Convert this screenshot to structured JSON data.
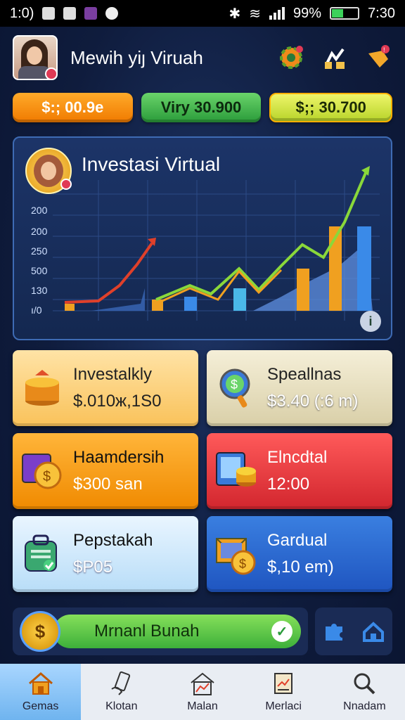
{
  "status": {
    "time_left": "1:0)",
    "battery": "99%",
    "time_right": "7:30"
  },
  "header": {
    "title": "Mewih yiȷ Viruah"
  },
  "pills": [
    "$:; 00.9e",
    "Viry 30.900",
    "$;; 30.700"
  ],
  "chart_card": {
    "title": "Investasi Virtual",
    "y_ticks": [
      "200",
      "200",
      "250",
      "500",
      "130",
      "ı/0"
    ],
    "colors": {
      "red": "#e0402a",
      "green": "#8ad83a",
      "orange": "#f0a020",
      "blue": "#3a78d8"
    }
  },
  "cards": [
    {
      "title": "Investalkly",
      "value": "$.010ж,1S0",
      "icon": "coin-stack-icon"
    },
    {
      "title": "Speallnas",
      "value": "$3.40 (:6 m)",
      "icon": "magnifier-dollar-icon"
    },
    {
      "title": "Haamdersih",
      "value": "$300 san",
      "icon": "tablet-coin-icon"
    },
    {
      "title": "Elncdtal",
      "value": "12:00",
      "icon": "tablet-coin-stack-icon"
    },
    {
      "title": "Pepstakah",
      "value": "$P05",
      "icon": "shield-bag-icon"
    },
    {
      "title": "Gardual",
      "value": "$,10 em)",
      "icon": "envelope-coin-icon"
    }
  ],
  "action": {
    "label": "Mrnanl Bunah"
  },
  "tabs": [
    "Gemas",
    "Klotan",
    "Malan",
    "Merlaci",
    "Nnadam"
  ]
}
